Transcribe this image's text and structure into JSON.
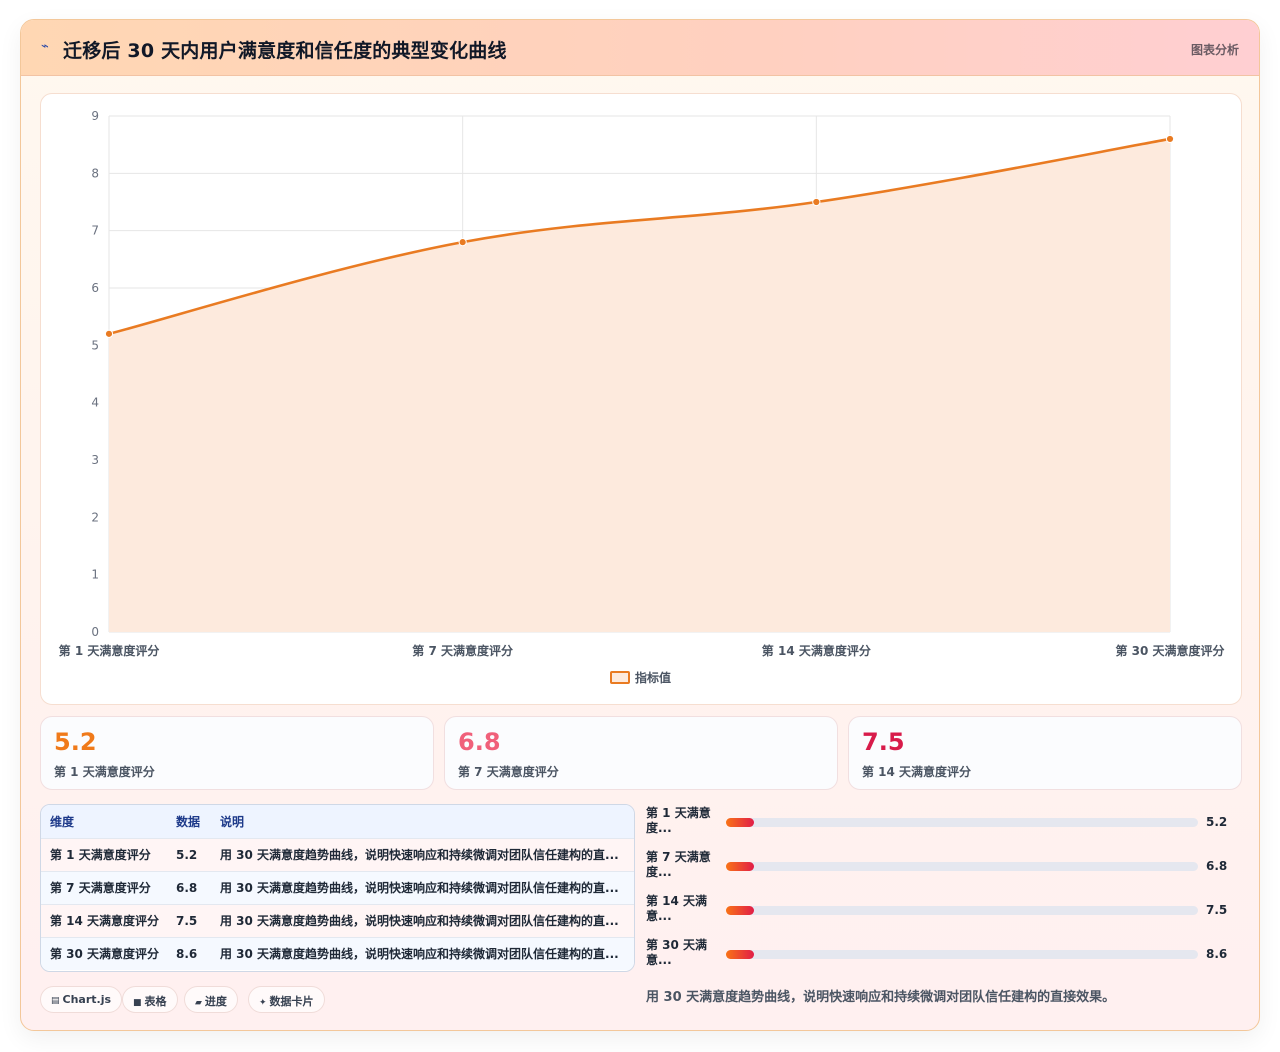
{
  "header": {
    "icon": "trend-line-icon",
    "title": "迁移后 30 天内用户满意度和信任度的典型变化曲线",
    "action": "图表分析"
  },
  "chart_data": {
    "type": "area",
    "categories": [
      "第 1 天满意度评分",
      "第 7 天满意度评分",
      "第 14 天满意度评分",
      "第 30 天满意度评分"
    ],
    "series": [
      {
        "name": "指标值",
        "values": [
          5.2,
          6.8,
          7.5,
          8.6
        ]
      }
    ],
    "ylim": [
      0,
      9
    ],
    "yticks": [
      "0",
      "1",
      "2",
      "3",
      "4",
      "5",
      "6",
      "7",
      "8",
      "9"
    ],
    "grid": true,
    "legend_position": "bottom",
    "line_color": "#e97b22",
    "fill_color": "#fdeadd"
  },
  "stats": [
    {
      "value": "5.2",
      "label": "第 1 天满意度评分",
      "color": "#f07a1a"
    },
    {
      "value": "6.8",
      "label": "第 7 天满意度评分",
      "color": "#f0607a"
    },
    {
      "value": "7.5",
      "label": "第 14 天满意度评分",
      "color": "#d81b4a"
    }
  ],
  "table": {
    "headers": [
      "维度",
      "数据",
      "说明"
    ],
    "rows": [
      [
        "第 1 天满意度评分",
        "5.2",
        "用 30 天满意度趋势曲线，说明快速响应和持续微调对团队信任建构的直..."
      ],
      [
        "第 7 天满意度评分",
        "6.8",
        "用 30 天满意度趋势曲线，说明快速响应和持续微调对团队信任建构的直..."
      ],
      [
        "第 14 天满意度评分",
        "7.5",
        "用 30 天满意度趋势曲线，说明快速响应和持续微调对团队信任建构的直..."
      ],
      [
        "第 30 天满意度评分",
        "8.6",
        "用 30 天满意度趋势曲线，说明快速响应和持续微调对团队信任建构的直..."
      ]
    ]
  },
  "progress": [
    {
      "label_line1": "第 1 天满意",
      "label_line2": "度...",
      "value": "5.2",
      "fraction": 0.06
    },
    {
      "label_line1": "第 7 天满意",
      "label_line2": "度...",
      "value": "6.8",
      "fraction": 0.06
    },
    {
      "label_line1": "第 14 天满",
      "label_line2": "意...",
      "value": "7.5",
      "fraction": 0.06
    },
    {
      "label_line1": "第 30 天满",
      "label_line2": "意...",
      "value": "8.6",
      "fraction": 0.06
    }
  ],
  "summary": "用 30 天满意度趋势曲线，说明快速响应和持续微调对团队信任建构的直接效果。",
  "chips": [
    {
      "icon": "chart-icon",
      "glyph": "▤",
      "label": "Chart.js"
    },
    {
      "icon": "table-icon",
      "glyph": "■",
      "label": "表格"
    },
    {
      "icon": "progress-icon",
      "glyph": "▰",
      "label": "进度"
    },
    {
      "icon": "sparkle-icon",
      "glyph": "✦",
      "label": "数据卡片"
    }
  ]
}
